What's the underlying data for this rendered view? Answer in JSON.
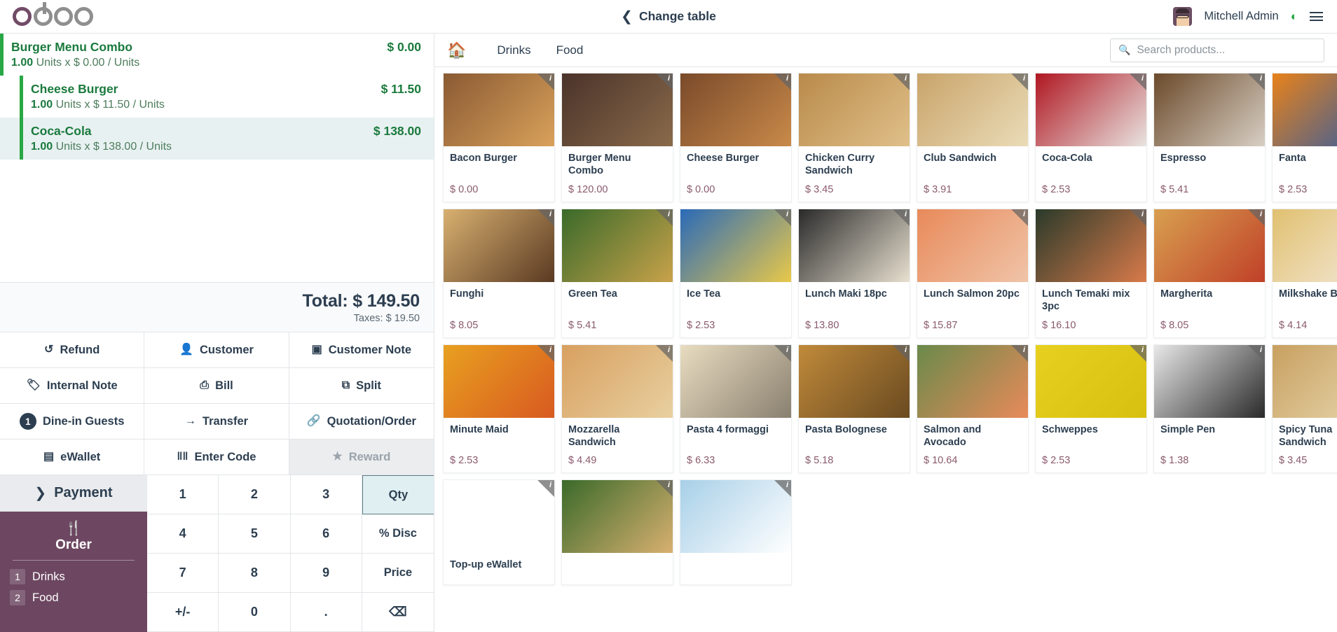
{
  "brand": {
    "name": "odoo"
  },
  "header": {
    "back_label": "Change table",
    "back_icon": "chevron-left-icon",
    "user_name": "Mitchell Admin",
    "wifi_icon": "wifi-icon",
    "menu_icon": "hamburger-menu-icon"
  },
  "order": {
    "lines": [
      {
        "name": "Burger Menu Combo",
        "qty": "1.00",
        "unit_text": "Units x $ 0.00 / Units",
        "price": "$ 0.00",
        "child": false,
        "selected": false
      },
      {
        "name": "Cheese Burger",
        "qty": "1.00",
        "unit_text": "Units x $ 11.50 / Units",
        "price": "$ 11.50",
        "child": true,
        "selected": false
      },
      {
        "name": "Coca-Cola",
        "qty": "1.00",
        "unit_text": "Units x $ 138.00 / Units",
        "price": "$ 138.00",
        "child": true,
        "selected": true
      }
    ],
    "total_label": "Total: $ 149.50",
    "taxes_label": "Taxes: $ 19.50"
  },
  "actions": [
    {
      "label": "Refund",
      "icon": "undo-icon",
      "glyph": "↺",
      "disabled": false
    },
    {
      "label": "Customer",
      "icon": "person-icon",
      "glyph": "👤",
      "disabled": false
    },
    {
      "label": "Customer Note",
      "icon": "note-icon",
      "glyph": "▣",
      "disabled": false
    },
    {
      "label": "Internal Note",
      "icon": "tag-icon",
      "glyph": "🏷",
      "disabled": false
    },
    {
      "label": "Bill",
      "icon": "printer-icon",
      "glyph": "⎙",
      "disabled": false
    },
    {
      "label": "Split",
      "icon": "copy-icon",
      "glyph": "⧉",
      "disabled": false
    },
    {
      "label": "Dine-in Guests",
      "icon": "guest-count-badge",
      "glyph": "1",
      "disabled": false
    },
    {
      "label": "Transfer",
      "icon": "arrow-right-icon",
      "glyph": "→",
      "disabled": false
    },
    {
      "label": "Quotation/Order",
      "icon": "link-icon",
      "glyph": "🔗",
      "disabled": false
    },
    {
      "label": "eWallet",
      "icon": "card-icon",
      "glyph": "▤",
      "disabled": false
    },
    {
      "label": "Enter Code",
      "icon": "barcode-icon",
      "glyph": "‖‖",
      "disabled": false
    },
    {
      "label": "Reward",
      "icon": "star-icon",
      "glyph": "★",
      "disabled": true
    }
  ],
  "payment": {
    "label": "Payment",
    "icon": "chevron-right-icon"
  },
  "order_panel": {
    "icon": "cutlery-icon",
    "title": "Order",
    "items": [
      {
        "num": "1",
        "label": "Drinks"
      },
      {
        "num": "2",
        "label": "Food"
      }
    ]
  },
  "numpad": [
    {
      "label": "1",
      "active": false
    },
    {
      "label": "2",
      "active": false
    },
    {
      "label": "3",
      "active": false
    },
    {
      "label": "Qty",
      "active": true
    },
    {
      "label": "4",
      "active": false
    },
    {
      "label": "5",
      "active": false
    },
    {
      "label": "6",
      "active": false
    },
    {
      "label": "% Disc",
      "active": false
    },
    {
      "label": "7",
      "active": false
    },
    {
      "label": "8",
      "active": false
    },
    {
      "label": "9",
      "active": false
    },
    {
      "label": "Price",
      "active": false
    },
    {
      "label": "+/-",
      "active": false
    },
    {
      "label": "0",
      "active": false
    },
    {
      "label": ".",
      "active": false
    },
    {
      "label": "⌫",
      "active": false
    }
  ],
  "catalog": {
    "home_icon": "home-icon",
    "tabs": [
      {
        "label": "Drinks"
      },
      {
        "label": "Food"
      }
    ],
    "search": {
      "placeholder": "Search products...",
      "value": "",
      "icon": "search-icon"
    },
    "products": [
      {
        "name": "Bacon Burger",
        "price": "$ 0.00",
        "img": "bacon-burger",
        "c1": "#8a5a33",
        "c2": "#d9a15a"
      },
      {
        "name": "Burger Menu Combo",
        "price": "$ 120.00",
        "img": "burger-menu-combo",
        "c1": "#4a332a",
        "c2": "#8a6a4a"
      },
      {
        "name": "Cheese Burger",
        "price": "$ 0.00",
        "img": "cheese-burger",
        "c1": "#7a4a2a",
        "c2": "#c98a4a"
      },
      {
        "name": "Chicken Curry Sandwich",
        "price": "$ 3.45",
        "img": "chicken-curry-sandwich",
        "c1": "#b98a4a",
        "c2": "#e0c08a"
      },
      {
        "name": "Club Sandwich",
        "price": "$ 3.91",
        "img": "club-sandwich",
        "c1": "#c9a46a",
        "c2": "#eadcb8"
      },
      {
        "name": "Coca-Cola",
        "price": "$ 2.53",
        "img": "coca-cola",
        "c1": "#b01722",
        "c2": "#e8e4e0"
      },
      {
        "name": "Espresso",
        "price": "$ 5.41",
        "img": "espresso",
        "c1": "#6b4a2a",
        "c2": "#d8cfc4"
      },
      {
        "name": "Fanta",
        "price": "$ 2.53",
        "img": "fanta",
        "c1": "#e8821a",
        "c2": "#2a5aa8"
      },
      {
        "name": "Funghi",
        "price": "$ 8.05",
        "img": "funghi-pizza",
        "c1": "#d8b070",
        "c2": "#5a3a22"
      },
      {
        "name": "Green Tea",
        "price": "$ 5.41",
        "img": "green-tea",
        "c1": "#3a6a2a",
        "c2": "#c8a24a"
      },
      {
        "name": "Ice Tea",
        "price": "$ 2.53",
        "img": "ice-tea",
        "c1": "#2a6ab8",
        "c2": "#e8c84a"
      },
      {
        "name": "Lunch Maki 18pc",
        "price": "$ 13.80",
        "img": "lunch-maki-18pc",
        "c1": "#2a2a2a",
        "c2": "#e8e0d0"
      },
      {
        "name": "Lunch Salmon 20pc",
        "price": "$ 15.87",
        "img": "lunch-salmon-20pc",
        "c1": "#e88a5a",
        "c2": "#f0c4a8"
      },
      {
        "name": "Lunch Temaki mix 3pc",
        "price": "$ 16.10",
        "img": "lunch-temaki-mix-3pc",
        "c1": "#2a3a2a",
        "c2": "#d87a4a"
      },
      {
        "name": "Margherita",
        "price": "$ 8.05",
        "img": "margherita-pizza",
        "c1": "#d8a050",
        "c2": "#c04028"
      },
      {
        "name": "Milkshake Banana",
        "price": "$ 4.14",
        "img": "milkshake-banana",
        "c1": "#e0c070",
        "c2": "#f4eadc"
      },
      {
        "name": "Minute Maid",
        "price": "$ 2.53",
        "img": "minute-maid",
        "c1": "#e8a020",
        "c2": "#d85a20"
      },
      {
        "name": "Mozzarella Sandwich",
        "price": "$ 4.49",
        "img": "mozzarella-sandwich",
        "c1": "#d8a060",
        "c2": "#e8d0a0"
      },
      {
        "name": "Pasta 4 formaggi",
        "price": "$ 6.33",
        "img": "pasta-4-formaggi",
        "c1": "#e8dcc0",
        "c2": "#8a8070"
      },
      {
        "name": "Pasta Bolognese",
        "price": "$ 5.18",
        "img": "pasta-bolognese",
        "c1": "#c08a3a",
        "c2": "#6a4a20"
      },
      {
        "name": "Salmon and Avocado",
        "price": "$ 10.64",
        "img": "salmon-and-avocado",
        "c1": "#6a8a4a",
        "c2": "#e88a5a"
      },
      {
        "name": "Schweppes",
        "price": "$ 2.53",
        "img": "schweppes",
        "c1": "#e8d020",
        "c2": "#d8c010"
      },
      {
        "name": "Simple Pen",
        "price": "$ 1.38",
        "img": "simple-pen",
        "c1": "#e8e8e8",
        "c2": "#2a2a2a"
      },
      {
        "name": "Spicy Tuna Sandwich",
        "price": "$ 3.45",
        "img": "spicy-tuna-sandwich",
        "c1": "#c8a060",
        "c2": "#e8d8b0"
      },
      {
        "name": "Top-up eWallet",
        "price": "",
        "img": "top-up-ewallet",
        "c1": "#ffffff",
        "c2": "#ffffff"
      },
      {
        "name": "",
        "price": "",
        "img": "vegetarian-pizza",
        "c1": "#3a6a2a",
        "c2": "#d8b070"
      },
      {
        "name": "",
        "price": "",
        "img": "water-bottle",
        "c1": "#a8d0e8",
        "c2": "#ffffff"
      }
    ]
  }
}
